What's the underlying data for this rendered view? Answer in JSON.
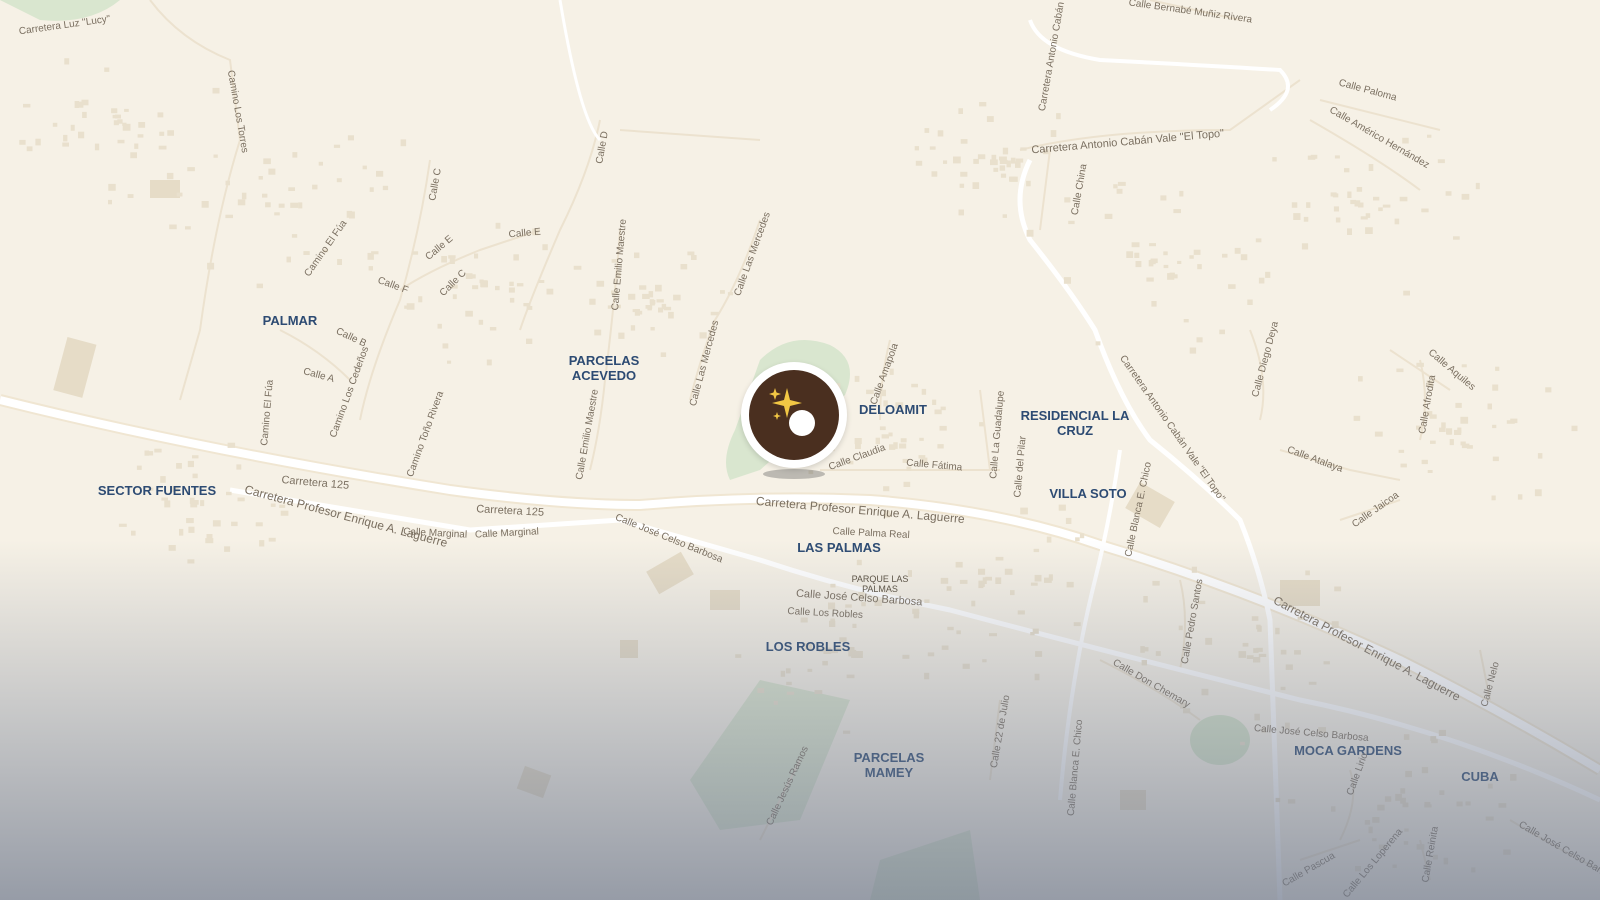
{
  "colors": {
    "land": "#f6f1e6",
    "road_major": "#ffffff",
    "road_minor": "#efe4cf",
    "building": "#e8dfcc",
    "park": "#d9e6cf",
    "place_label": "#2d4b73",
    "road_label": "#7a6f60",
    "marker": "#4a2f1f",
    "sparkle": "#f2c744"
  },
  "marker": {
    "icon": "sparkle-icon",
    "name": "location-pin"
  },
  "places": [
    {
      "name": "PALMAR"
    },
    {
      "name": "PARCELAS ACEVEDO"
    },
    {
      "name": "DELOAMIT"
    },
    {
      "name": "RESIDENCIAL LA CRUZ"
    },
    {
      "name": "VILLA SOTO"
    },
    {
      "name": "SECTOR FUENTES"
    },
    {
      "name": "LAS PALMAS"
    },
    {
      "name": "LOS ROBLES"
    },
    {
      "name": "PARCELAS MAMEY"
    },
    {
      "name": "MOCA GARDENS"
    },
    {
      "name": "CUBA"
    },
    {
      "name": "PARQUE LAS PALMAS"
    }
  ],
  "roads": [
    "Carretera Luz \"Lucy\"",
    "Camino Los Torres",
    "Calle D",
    "Calle C",
    "Calle E",
    "Camino El Fúa",
    "Calle F",
    "Calle B",
    "Calle A",
    "Calle Emilio Maestre",
    "Calle Las Mercedes",
    "Camino Los Cedeños",
    "Camino Toño Rivera",
    "Carretera 125",
    "Carretera Profesor Enrique A. Laguerre",
    "Calle Marginal",
    "Calle José Celso Barbosa",
    "Calle Palma Real",
    "Calle Los Robles",
    "Calle Amapola",
    "Calle Claudia",
    "Calle Fátima",
    "Calle La Guadalupe",
    "Calle del Pilar",
    "Calle Blanca E. Chico",
    "Carretera Antonio Cabán Vale \"El Topo\"",
    "Calle China",
    "Calle Bernabé Muñiz Rivera",
    "Calle Paloma",
    "Calle Américo Hernández",
    "Calle Diego Deya",
    "Calle Afrodita",
    "Calle Aquiles",
    "Calle Atalaya",
    "Calle Jaicoa",
    "Calle Pedro Santos",
    "Calle Don Chemary",
    "Calle 22 de Julio",
    "Calle Jesús Ramos",
    "Calle Nelo",
    "Calle Lirio",
    "Calle Pascua",
    "Calle Los Loperena",
    "Calle Reinita"
  ]
}
